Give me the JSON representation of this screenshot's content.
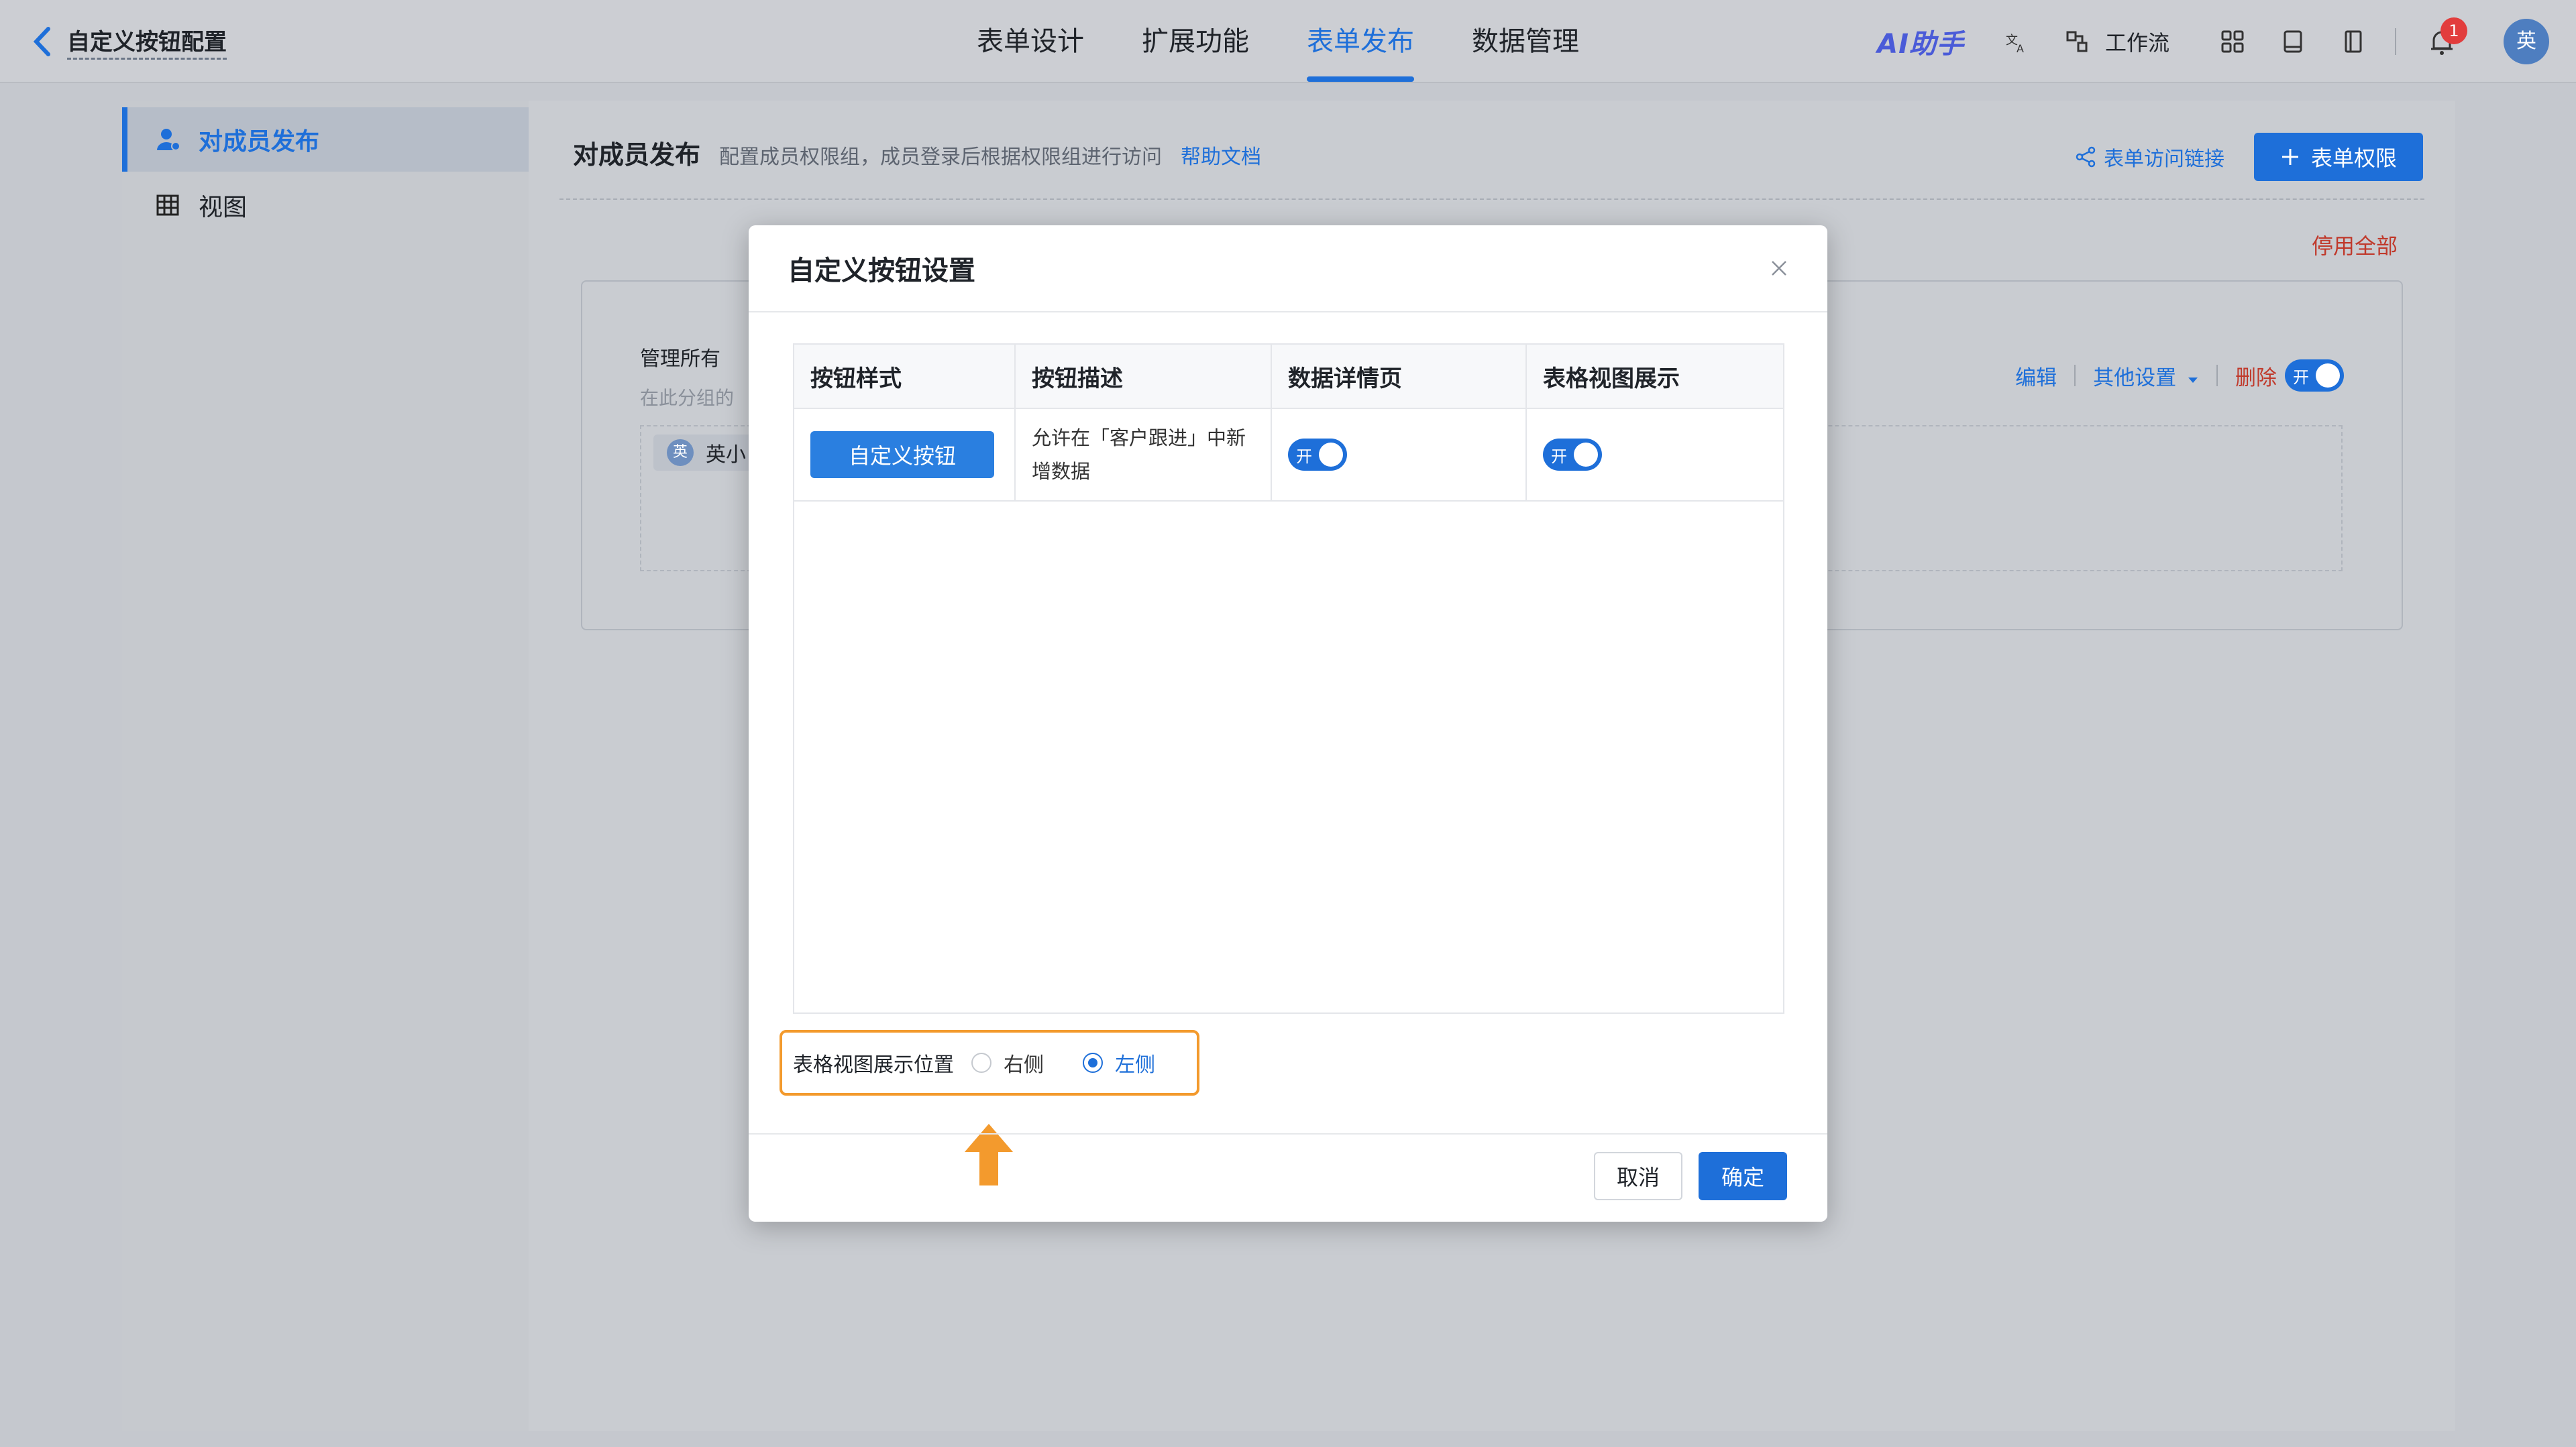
{
  "topbar": {
    "back_title": "自定义按钮配置",
    "nav": [
      "表单设计",
      "扩展功能",
      "表单发布",
      "数据管理"
    ],
    "active_nav": "表单发布",
    "ai_label": "AI助手",
    "workflow_label": "工作流",
    "notification_count": "1",
    "avatar_text": "英"
  },
  "sidebar": {
    "items": [
      {
        "label": "对成员发布",
        "icon": "user-icon",
        "active": true
      },
      {
        "label": "视图",
        "icon": "table-icon",
        "active": false
      }
    ]
  },
  "main": {
    "title": "对成员发布",
    "description": "配置成员权限组，成员登录后根据权限组进行访问",
    "help_link": "帮助文档",
    "access_link": "表单访问链接",
    "permission_button": "表单权限",
    "disable_all": "停用全部",
    "group": {
      "title": "管理所有",
      "subtitle": "在此分组的",
      "member_avatar": "英",
      "member_name": "英小",
      "actions": {
        "edit": "编辑",
        "other": "其他设置",
        "delete": "删除",
        "toggle": "开"
      }
    }
  },
  "modal": {
    "title": "自定义按钮设置",
    "columns": [
      "按钮样式",
      "按钮描述",
      "数据详情页",
      "表格视图展示"
    ],
    "rows": [
      {
        "button_label": "自定义按钮",
        "description": "允许在「客户跟进」中新增数据",
        "detail_toggle": "开",
        "table_toggle": "开"
      }
    ],
    "position": {
      "label": "表格视图展示位置",
      "options": [
        "右侧",
        "左侧"
      ],
      "selected": "左侧"
    },
    "cancel": "取消",
    "ok": "确定"
  },
  "colors": {
    "accent": "#1e6fd9",
    "highlight": "#f39a2d",
    "danger": "#c0392b"
  }
}
